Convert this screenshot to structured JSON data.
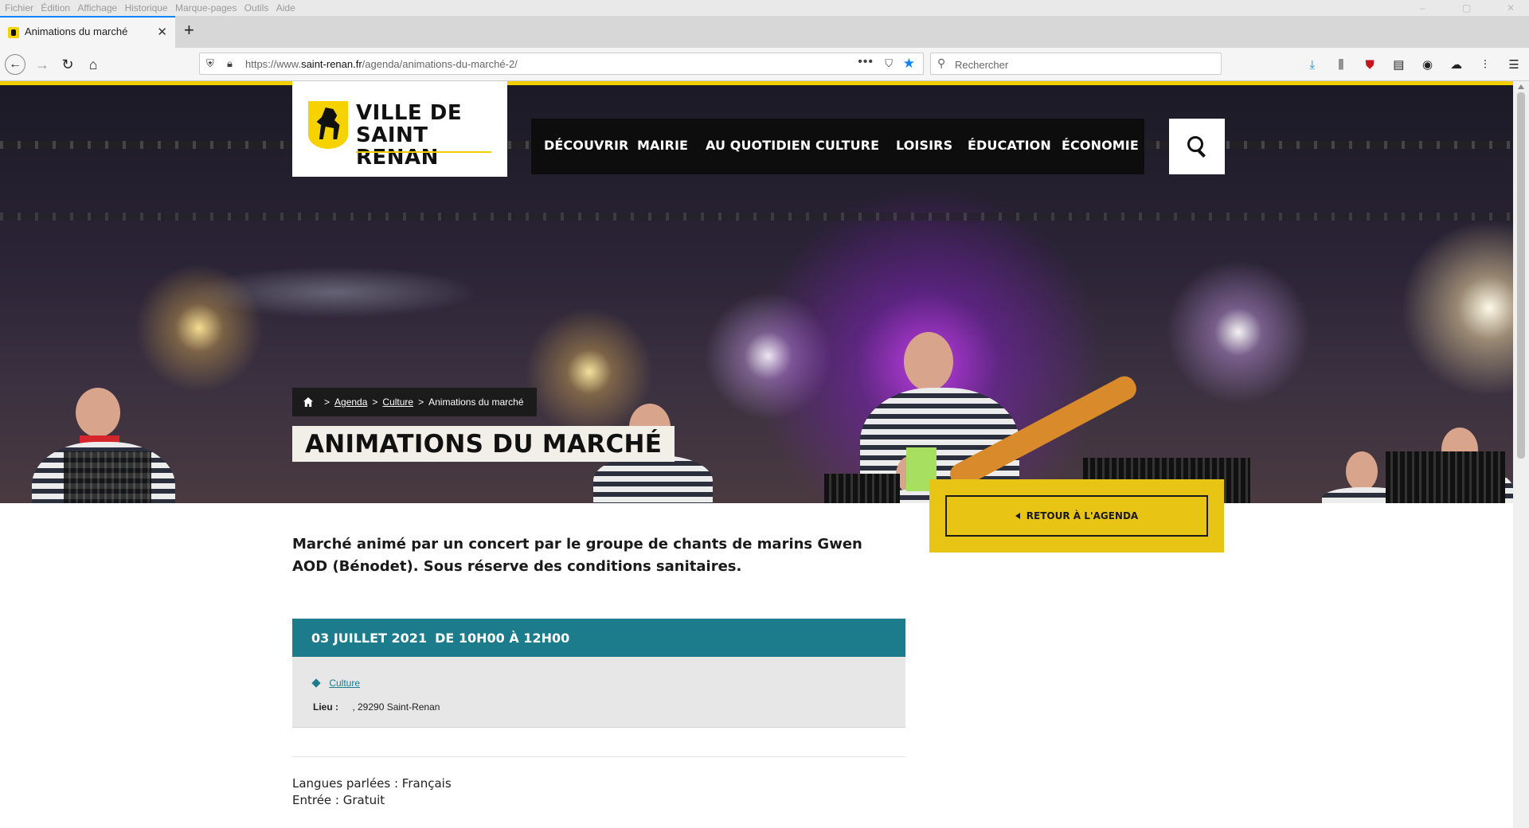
{
  "browser": {
    "menu": [
      "Fichier",
      "Édition",
      "Affichage",
      "Historique",
      "Marque-pages",
      "Outils",
      "Aide"
    ],
    "tab": {
      "title": "Animations du marché",
      "close": "✕"
    },
    "new_tab": "+",
    "url_prefix": "https://www.",
    "url_host": "saint-renan.fr",
    "url_path": "/agenda/animations-du-marché-2/",
    "search_placeholder": "Rechercher",
    "icons": [
      "download-icon",
      "library-icon",
      "ublock-icon",
      "reader-icon",
      "extension-icon",
      "extension-icon-2",
      "sync-icon",
      "menu-icon"
    ]
  },
  "site": {
    "logo_line1": "VILLE DE",
    "logo_line2": "SAINT RENAN",
    "nav": [
      "DÉCOUVRIR",
      "MAIRIE",
      "AU QUOTIDIEN",
      "CULTURE",
      "LOISIRS",
      "ÉDUCATION",
      "ÉCONOMIE"
    ]
  },
  "breadcrumb": {
    "sep": ">",
    "items": [
      "Agenda",
      "Culture",
      "Animations du marché"
    ]
  },
  "page": {
    "title": "ANIMATIONS DU MARCHÉ",
    "retour": "RETOUR À L'AGENDA",
    "intro": "Marché animé par un concert par le groupe de chants de marins Gwen AOD (Bénodet). Sous réserve des conditions sanitaires.",
    "date": "03 JUILLET 2021",
    "time": "DE 10H00 À 12H00",
    "category": "Culture",
    "lieu_label": "Lieu :",
    "lieu_value": ", 29290 Saint-Renan",
    "langues": "Langues parlées : Français",
    "entree": "Entrée : Gratuit"
  },
  "colors": {
    "brand_yellow": "#f2cf00",
    "teal": "#1c7c8c",
    "nav_bg": "#0d0d0d"
  }
}
